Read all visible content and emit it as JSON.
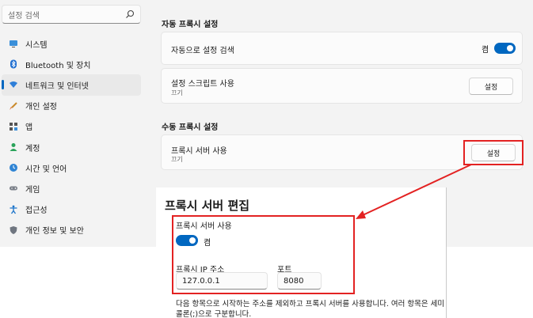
{
  "search": {
    "placeholder": "설정 검색",
    "icon": "search-icon"
  },
  "sidebar": {
    "items": [
      {
        "label": "시스템",
        "icon": "monitor-icon"
      },
      {
        "label": "Bluetooth 및 장치",
        "icon": "bluetooth-icon"
      },
      {
        "label": "네트워크 및 인터넷",
        "icon": "wifi-icon",
        "active": true
      },
      {
        "label": "개인 설정",
        "icon": "brush-icon"
      },
      {
        "label": "앱",
        "icon": "apps-icon"
      },
      {
        "label": "계정",
        "icon": "person-icon"
      },
      {
        "label": "시간 및 언어",
        "icon": "globe-clock-icon"
      },
      {
        "label": "게임",
        "icon": "gamepad-icon"
      },
      {
        "label": "접근성",
        "icon": "accessibility-icon"
      },
      {
        "label": "개인 정보 및 보안",
        "icon": "shield-icon"
      }
    ]
  },
  "auto_proxy": {
    "section_title": "자동 프록시 설정",
    "detect": {
      "title": "자동으로 설정 검색",
      "toggle_label": "켬",
      "on": true
    },
    "script": {
      "title": "설정 스크립트 사용",
      "subtitle": "끄기",
      "button": "설정"
    }
  },
  "manual_proxy": {
    "section_title": "수동 프록시 설정",
    "server": {
      "title": "프록시 서버 사용",
      "subtitle": "끄기",
      "button": "설정"
    }
  },
  "dialog": {
    "title": "프록시 서버 편집",
    "use_proxy_label": "프록시 서버 사용",
    "toggle_label": "켬",
    "toggle_on": true,
    "ip_label": "프록시 IP 주소",
    "ip_value": "127.0.0.1",
    "port_label": "포트",
    "port_value": "8080",
    "description": "다음 항목으로 시작하는 주소를 제외하고 프록시 서버를 사용합니다. 여러 항목은 세미콜론(;)으로 구분합니다."
  },
  "colors": {
    "accent": "#0067c0",
    "annotation": "#e32222"
  }
}
